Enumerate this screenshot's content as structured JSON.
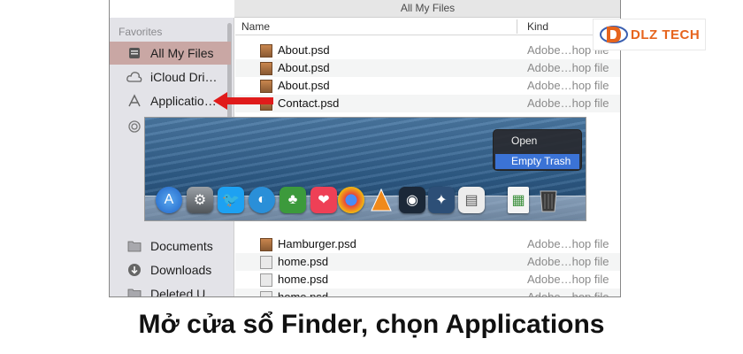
{
  "window": {
    "title": "All My Files"
  },
  "sidebar": {
    "section_title": "Favorites",
    "items": [
      {
        "label": "All My Files",
        "icon": "all-files-icon",
        "selected": true
      },
      {
        "label": "iCloud Dri…",
        "icon": "cloud-icon",
        "selected": false
      },
      {
        "label": "Applicatio…",
        "icon": "applications-icon",
        "selected": false
      },
      {
        "label": "Documents",
        "icon": "documents-icon",
        "selected": false
      },
      {
        "label": "Downloads",
        "icon": "downloads-icon",
        "selected": false
      },
      {
        "label": "Deleted U…",
        "icon": "folder-icon",
        "selected": false
      }
    ]
  },
  "list": {
    "columns": {
      "name": "Name",
      "kind": "Kind"
    },
    "rows_top": [
      {
        "name": "About.psd",
        "kind": "Adobe…hop file",
        "type": "psd"
      },
      {
        "name": "About.psd",
        "kind": "Adobe…hop file",
        "type": "psd"
      },
      {
        "name": "About.psd",
        "kind": "Adobe…hop file",
        "type": "psd"
      },
      {
        "name": "Contact.psd",
        "kind": "Adobe…hop file",
        "type": "psd"
      }
    ],
    "rows_bottom": [
      {
        "name": "Hamburger.psd",
        "kind": "Adobe…hop file",
        "type": "psd"
      },
      {
        "name": "home.psd",
        "kind": "Adobe…hop file",
        "type": "doc"
      },
      {
        "name": "home.psd",
        "kind": "Adobe…hop file",
        "type": "doc"
      },
      {
        "name": "home.psd",
        "kind": "Adobe…hop file",
        "type": "doc"
      }
    ]
  },
  "dock": {
    "icons": [
      "app-store-icon",
      "preferences-icon",
      "twitter-icon",
      "browser-icon",
      "evernote-icon",
      "pocket-icon",
      "chrome-icon",
      "vlc-icon",
      "steam-icon",
      "xcode-icon",
      "activity-icon",
      "document-icon",
      "trash-icon"
    ],
    "context_menu": {
      "items": [
        {
          "label": "Open",
          "active": false
        },
        {
          "label": "Empty Trash",
          "active": true
        }
      ]
    }
  },
  "logo": {
    "text": "DLZ TECH",
    "accent": "#e6641d"
  },
  "caption": "Mở cửa sổ Finder, chọn Applications",
  "colors": {
    "selection": "#c9a7a4",
    "arrow": "#e01b1b",
    "menu_active": "#3b73d6"
  }
}
